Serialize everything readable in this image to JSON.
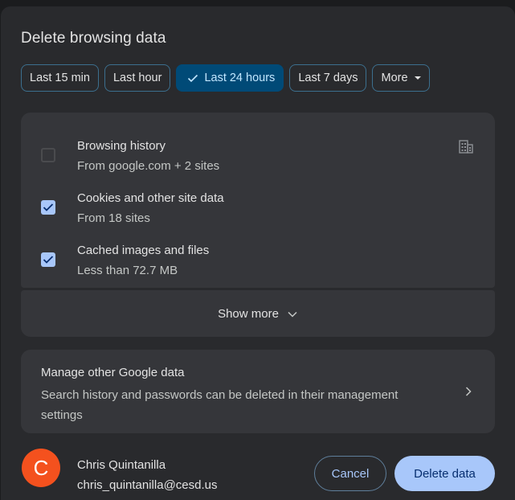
{
  "dialog": {
    "title": "Delete browsing data"
  },
  "time_ranges": [
    {
      "label": "Last 15 min",
      "selected": false
    },
    {
      "label": "Last hour",
      "selected": false
    },
    {
      "label": "Last 24 hours",
      "selected": true
    },
    {
      "label": "Last 7 days",
      "selected": false
    },
    {
      "label": "More",
      "selected": false
    }
  ],
  "items": [
    {
      "title": "Browsing history",
      "subtitle": "From google.com + 2 sites",
      "checked": false,
      "icon": "building-icon"
    },
    {
      "title": "Cookies and other site data",
      "subtitle": "From 18 sites",
      "checked": true
    },
    {
      "title": "Cached images and files",
      "subtitle": "Less than 72.7 MB",
      "checked": true
    }
  ],
  "show_more": {
    "label": "Show more",
    "icon": "chevron-down-icon"
  },
  "manage": {
    "title": "Manage other Google data",
    "description": "Search history and passwords can be deleted in their management settings",
    "icon": "chevron-right-icon"
  },
  "account": {
    "initial": "C",
    "name": "Chris Quintanilla",
    "email": "chris_quintanilla@cesd.us",
    "avatar_color": "#f4511e"
  },
  "actions": {
    "cancel_label": "Cancel",
    "delete_label": "Delete data"
  },
  "colors": {
    "accent": "#a8c7fa",
    "selected_chip_bg": "#004a77",
    "surface": "#292a2d",
    "card": "#35363a"
  }
}
